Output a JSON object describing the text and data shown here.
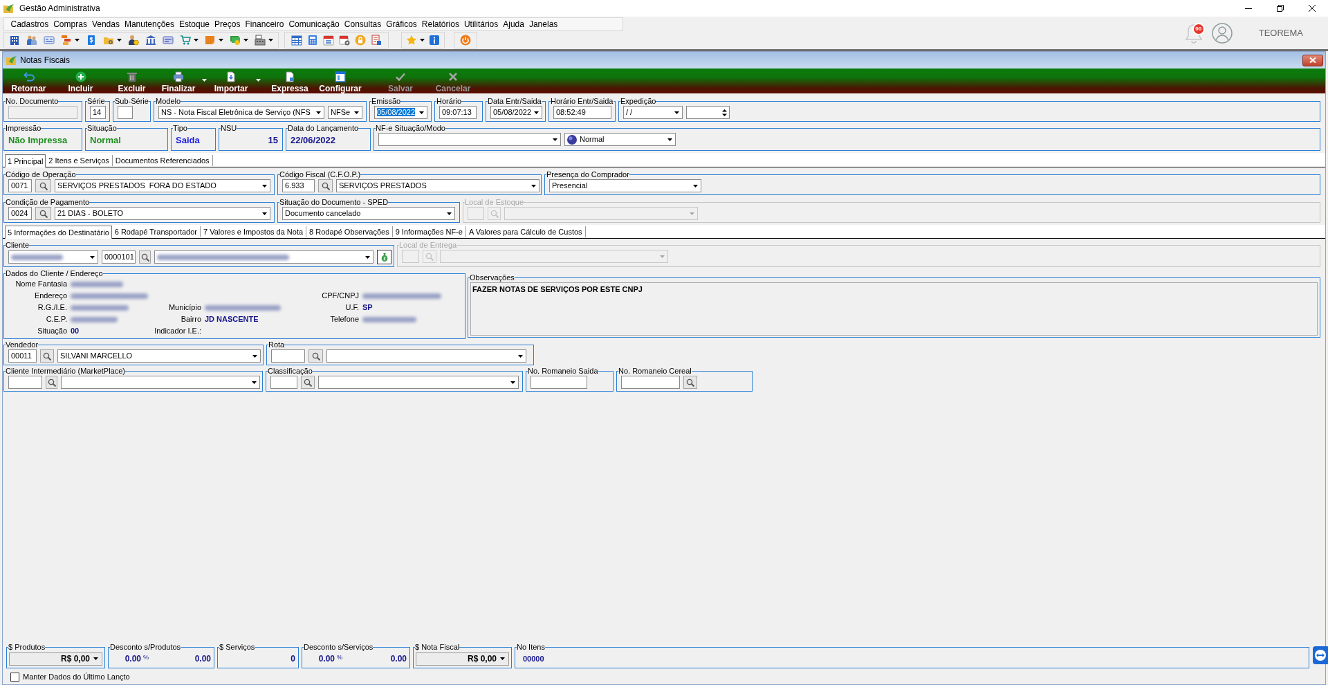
{
  "window": {
    "title": "Gestão Administrativa"
  },
  "menu": [
    "Cadastros",
    "Compras",
    "Vendas",
    "Manutenções",
    "Estoque",
    "Preços",
    "Financeiro",
    "Comunicação",
    "Consultas",
    "Gráficos",
    "Relatórios",
    "Utilitários",
    "Ajuda",
    "Janelas"
  ],
  "notifications": {
    "count": "00"
  },
  "user": {
    "name": "TEOREMA"
  },
  "form": {
    "title": "Notas Fiscais",
    "actions": [
      {
        "label": "Retornar",
        "disabled": false,
        "dropdown": false
      },
      {
        "label": "Incluir",
        "disabled": false,
        "dropdown": false
      },
      {
        "label": "Excluir",
        "disabled": false,
        "dropdown": false
      },
      {
        "label": "Finalizar",
        "disabled": false,
        "dropdown": true
      },
      {
        "label": "Importar",
        "disabled": false,
        "dropdown": true
      },
      {
        "label": "Expressa",
        "disabled": false,
        "dropdown": false
      },
      {
        "label": "Configurar",
        "disabled": false,
        "dropdown": false
      },
      {
        "label": "Salvar",
        "disabled": true,
        "dropdown": false
      },
      {
        "label": "Cancelar",
        "disabled": true,
        "dropdown": false
      }
    ],
    "header_rows": [
      {
        "groups": [
          {
            "label": "No. Documento",
            "fields": [
              {
                "kind": "readonly"
              }
            ]
          },
          {
            "label": "Série",
            "fields": [
              {
                "kind": "input",
                "value": "14"
              }
            ]
          },
          {
            "label": "Sub-Série",
            "fields": [
              {
                "kind": "input"
              }
            ]
          },
          {
            "label": "Modelo",
            "fields": [
              {
                "kind": "select",
                "value": "NS - Nota Fiscal Eletrônica de Serviço (NFS"
              },
              {
                "kind": "select",
                "value": "NFSe"
              }
            ]
          },
          {
            "label": "Emissão",
            "fields": [
              {
                "kind": "select",
                "value": "05/08/2022",
                "text_selected": true
              }
            ]
          },
          {
            "label": "Horário",
            "fields": [
              {
                "kind": "input",
                "value": "09:07:13"
              }
            ]
          },
          {
            "label": "Data Entr/Saida",
            "fields": [
              {
                "kind": "select",
                "value": "05/08/2022"
              }
            ]
          },
          {
            "label": "Horário Entr/Saida",
            "fields": [
              {
                "kind": "input",
                "value": "08:52:49"
              }
            ]
          },
          {
            "label": "Expedição",
            "fields": [
              {
                "kind": "select",
                "value": "/ /"
              },
              {
                "kind": "spin"
              }
            ]
          }
        ]
      },
      {
        "groups": [
          {
            "label": "Impressão",
            "fields": [
              {
                "kind": "status",
                "value": "Não Impressa",
                "color": "#1e8f1e"
              }
            ]
          },
          {
            "label": "Situação",
            "fields": [
              {
                "kind": "status",
                "value": "Normal",
                "color": "#1e8f1e"
              }
            ]
          },
          {
            "label": "Tipo",
            "fields": [
              {
                "kind": "status",
                "value": "Saida",
                "color": "#1a1ae6"
              }
            ]
          },
          {
            "label": "NSU",
            "fields": [
              {
                "kind": "number",
                "value": "15",
                "color": "#14148c"
              }
            ]
          },
          {
            "label": "Data do Lançamento",
            "fields": [
              {
                "kind": "status",
                "value": "22/06/2022",
                "color": "#14148c"
              }
            ]
          },
          {
            "label": "NF-e Situação/Modo",
            "fields": [
              {
                "kind": "select"
              },
              {
                "kind": "flagselect",
                "value": "Normal"
              }
            ]
          }
        ]
      }
    ],
    "main_tabs": [
      {
        "label": "1 Principal",
        "selected": true
      },
      {
        "label": "2 Itens e Serviços",
        "selected": false
      },
      {
        "label": "Documentos Referenciados",
        "selected": false
      }
    ],
    "principal_rows": [
      {
        "groups": [
          {
            "label": "Código de Operação",
            "disabled": false,
            "fields": [
              {
                "kind": "input",
                "value": "0071"
              },
              {
                "kind": "search"
              },
              {
                "kind": "select",
                "value": "SERVIÇOS PRESTADOS  FORA DO ESTADO"
              }
            ]
          },
          {
            "label": "Código Fiscal (C.F.O.P.)",
            "disabled": false,
            "fields": [
              {
                "kind": "input",
                "value": "6.933"
              },
              {
                "kind": "search"
              },
              {
                "kind": "select",
                "value": "SERVIÇOS PRESTADOS"
              }
            ]
          },
          {
            "label": "Presença do Comprador",
            "disabled": false,
            "fields": [
              {
                "kind": "select",
                "value": "Presencial"
              }
            ]
          }
        ]
      },
      {
        "groups": [
          {
            "label": "Condição de Pagamento",
            "disabled": false,
            "fields": [
              {
                "kind": "input",
                "value": "0024"
              },
              {
                "kind": "search"
              },
              {
                "kind": "select",
                "value": "21 DIAS - BOLETO"
              }
            ]
          },
          {
            "label": "Situação do Documento - SPED",
            "disabled": false,
            "fields": [
              {
                "kind": "select",
                "value": "Documento cancelado"
              }
            ]
          },
          {
            "label": "Local de Estoque",
            "disabled": true,
            "fields": [
              {
                "kind": "input"
              },
              {
                "kind": "search"
              },
              {
                "kind": "select"
              }
            ]
          }
        ]
      }
    ],
    "detail_tabs": [
      {
        "label": "5 Informações do Destinatário",
        "selected": true
      },
      {
        "label": "6 Rodapé Transportador",
        "selected": false
      },
      {
        "label": "7 Valores e Impostos da Nota",
        "selected": false
      },
      {
        "label": "8 Rodapé Observações",
        "selected": false
      },
      {
        "label": "9 Informações NF-e",
        "selected": false
      },
      {
        "label": "A Valores para Cálculo de Custos",
        "selected": false
      }
    ],
    "client_rows": [
      {
        "groups": [
          {
            "label": "Cliente",
            "disabled": false,
            "fields": [
              {
                "kind": "blurred"
              },
              {
                "kind": "input",
                "value": "0000101"
              },
              {
                "kind": "search"
              },
              {
                "kind": "blurred"
              },
              {
                "kind": "iconbutton"
              }
            ]
          },
          {
            "label": "Local de Entrega",
            "disabled": true,
            "fields": [
              {
                "kind": "input"
              },
              {
                "kind": "search"
              },
              {
                "kind": "select"
              }
            ]
          }
        ]
      }
    ],
    "client_data": {
      "label": "Dados do Cliente / Endereço",
      "rows": [
        {
          "left": {
            "label": "Nome Fantasia",
            "kind": "blurred"
          }
        },
        {
          "left": {
            "label": "Endereço",
            "kind": "blurred"
          },
          "right": {
            "label": "CPF/CNPJ",
            "kind": "blurred"
          }
        },
        {
          "left": {
            "label": "R.G./I.E.",
            "kind": "blurred"
          },
          "middle": {
            "label": "Município",
            "kind": "blurred"
          },
          "right": {
            "label": "U.F.",
            "kind": "text",
            "value": "SP"
          }
        },
        {
          "left": {
            "label": "C.E.P.",
            "kind": "blurred"
          },
          "middle": {
            "label": "Bairro",
            "kind": "text",
            "value": "JD NASCENTE"
          },
          "right": {
            "label": "Telefone",
            "kind": "blurred"
          }
        },
        {
          "left": {
            "label": "Situação",
            "kind": "text",
            "value": "00"
          },
          "middle": {
            "label": "Indicador I.E.:",
            "kind": "text"
          }
        }
      ]
    },
    "observations": {
      "label": "Observações",
      "text": "FAZER NOTAS DE SERVIÇOS POR ESTE CNPJ"
    },
    "extra_rows": [
      {
        "groups": [
          {
            "label": "Vendedor",
            "fields": [
              {
                "kind": "input",
                "value": "00011"
              },
              {
                "kind": "search"
              },
              {
                "kind": "select",
                "value": "SILVANI MARCELLO"
              }
            ]
          },
          {
            "label": "Rota",
            "fields": [
              {
                "kind": "input"
              },
              {
                "kind": "search"
              },
              {
                "kind": "select"
              }
            ]
          }
        ]
      },
      {
        "groups": [
          {
            "label": "Cliente Intermediário (MarketPlace)",
            "fields": [
              {
                "kind": "input"
              },
              {
                "kind": "search"
              },
              {
                "kind": "select"
              }
            ]
          },
          {
            "label": "Classificação",
            "fields": [
              {
                "kind": "input"
              },
              {
                "kind": "search"
              },
              {
                "kind": "select"
              }
            ]
          },
          {
            "label": "No. Romaneio Saida",
            "fields": [
              {
                "kind": "input"
              }
            ]
          },
          {
            "label": "No. Romaneio Cereal",
            "fields": [
              {
                "kind": "input"
              },
              {
                "kind": "search"
              }
            ]
          }
        ]
      }
    ],
    "totals": [
      {
        "label": "$ Produtos",
        "kind": "combo",
        "value": "R$ 0,00"
      },
      {
        "label": "Desconto s/Produtos",
        "kind": "discount",
        "percent": "0.00",
        "sign": "%",
        "amount": "0.00"
      },
      {
        "label": "$ Serviços",
        "kind": "amount",
        "value": "0"
      },
      {
        "label": "Desconto s/Serviços",
        "kind": "discount",
        "percent": "0.00",
        "sign": "%",
        "amount": "0.00"
      },
      {
        "label": "$ Nota Fiscal",
        "kind": "combo",
        "value": "R$ 0,00"
      },
      {
        "label": "No Itens",
        "kind": "count",
        "value": "00000"
      }
    ],
    "keep_data": {
      "label": "Manter Dados do Último Lançto",
      "checked": false
    }
  }
}
